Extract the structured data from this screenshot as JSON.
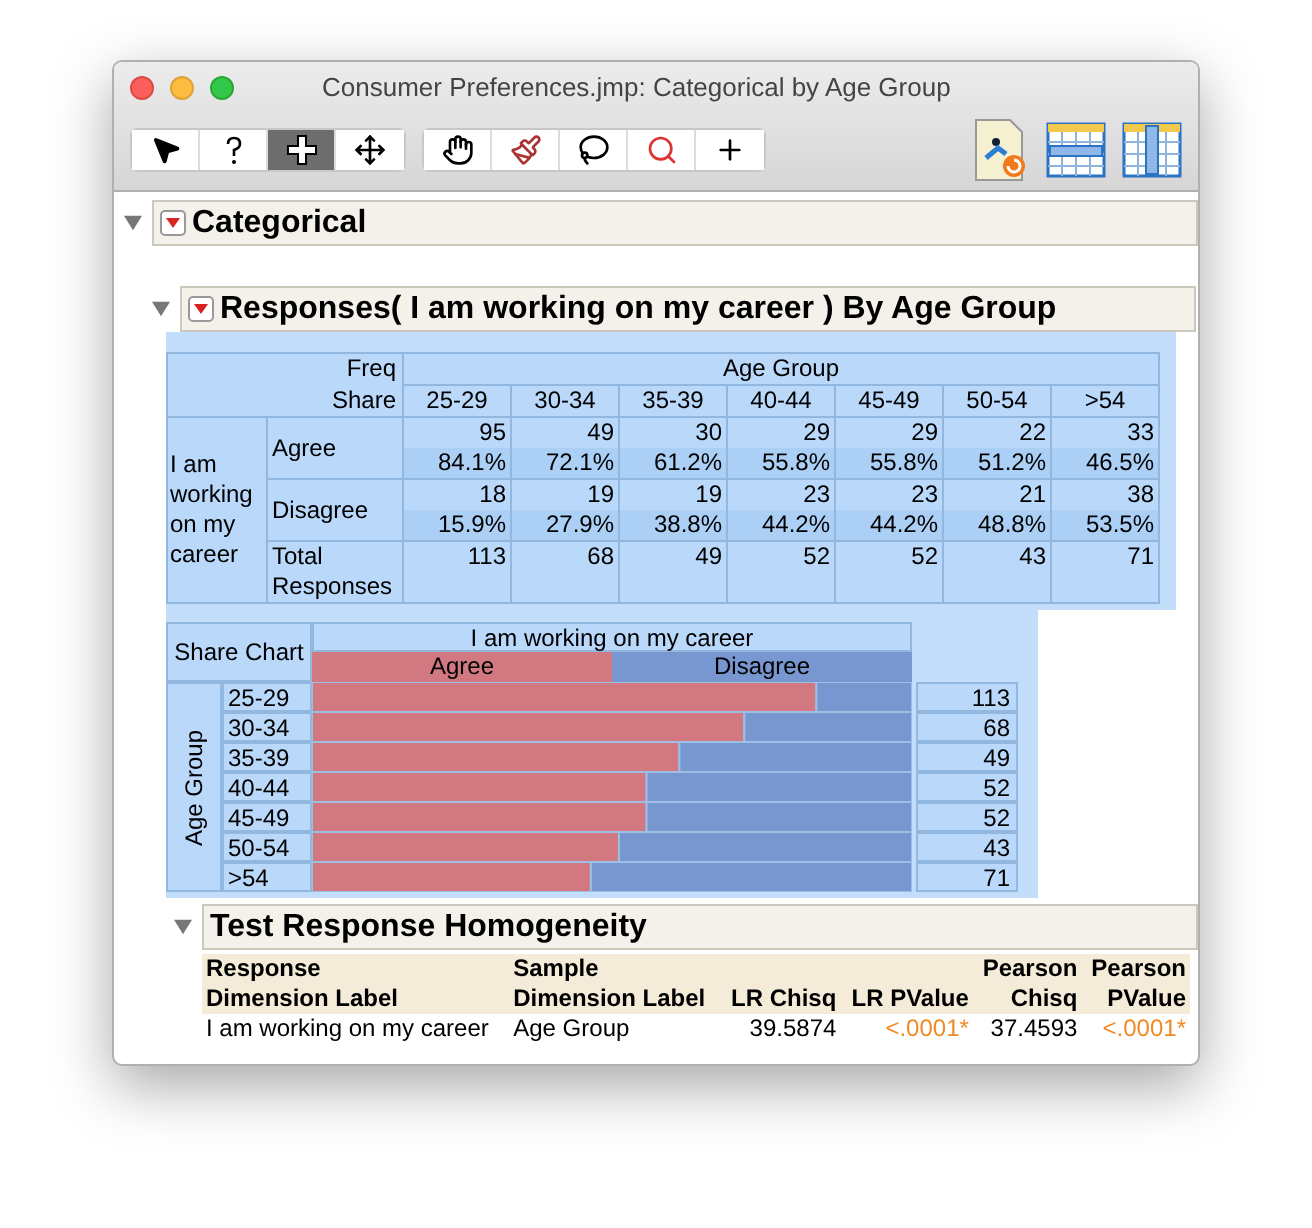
{
  "window": {
    "title": "Consumer Preferences.jmp: Categorical by Age Group"
  },
  "toolbar": {
    "tools": [
      {
        "kind": "arrow",
        "selected": false
      },
      {
        "kind": "help",
        "selected": false
      },
      {
        "kind": "crosshair",
        "selected": true
      },
      {
        "kind": "move",
        "selected": false
      },
      {
        "kind": "hand",
        "selected": false
      },
      {
        "kind": "brush",
        "selected": false
      },
      {
        "kind": "lasso",
        "selected": false
      },
      {
        "kind": "magnifier",
        "selected": false
      },
      {
        "kind": "crosshair_xy",
        "selected": false
      }
    ]
  },
  "report": {
    "title": "Categorical",
    "expanded": true,
    "responses": {
      "title": "Responses( I am working on my career ) By Age Group",
      "expanded": true,
      "contingency": {
        "freq_label": "Freq",
        "share_label": "Share",
        "group_header": "Age Group",
        "columns": [
          "25-29",
          "30-34",
          "35-39",
          "40-44",
          "45-49",
          "50-54",
          ">54"
        ],
        "row_variable": "I am working on my career",
        "rows": [
          {
            "label": "Agree",
            "counts": [
              "95",
              "49",
              "30",
              "29",
              "29",
              "22",
              "33"
            ],
            "shares": [
              "84.1%",
              "72.1%",
              "61.2%",
              "55.8%",
              "55.8%",
              "51.2%",
              "46.5%"
            ]
          },
          {
            "label": "Disagree",
            "counts": [
              "18",
              "19",
              "19",
              "23",
              "23",
              "21",
              "38"
            ],
            "shares": [
              "15.9%",
              "27.9%",
              "38.8%",
              "44.2%",
              "44.2%",
              "48.8%",
              "53.5%"
            ]
          }
        ],
        "total_label": "Total Responses",
        "totals": [
          "113",
          "68",
          "49",
          "52",
          "52",
          "43",
          "71"
        ]
      },
      "share_chart": {
        "title": "Share Chart",
        "header": "I am working on my career",
        "group_label": "Age Group",
        "totals": [
          "113",
          "68",
          "49",
          "52",
          "52",
          "43",
          "71"
        ],
        "categories": [
          "25-29",
          "30-34",
          "35-39",
          "40-44",
          "45-49",
          "50-54",
          ">54"
        ],
        "legend": [
          {
            "name": "Agree",
            "color": "#d27880"
          },
          {
            "name": "Disagree",
            "color": "#7897d1"
          }
        ]
      }
    },
    "homogeneity": {
      "title": "Test Response Homogeneity",
      "expanded": true,
      "columns": [
        {
          "lines": [
            "Response",
            "Dimension Label"
          ]
        },
        {
          "lines": [
            "Sample",
            "Dimension Label"
          ]
        },
        {
          "lines": [
            "LR Chisq"
          ]
        },
        {
          "lines": [
            "LR PValue"
          ]
        },
        {
          "lines": [
            "Pearson",
            "Chisq"
          ]
        },
        {
          "lines": [
            "Pearson",
            "PValue"
          ]
        }
      ],
      "rows": [
        [
          {
            "text": "I am working on my career",
            "kind": "text"
          },
          {
            "text": "Age Group",
            "kind": "text"
          },
          {
            "text": "39.5874",
            "kind": "number"
          },
          {
            "text": "<.0001*",
            "kind": "pvalue"
          },
          {
            "text": "37.4593",
            "kind": "number"
          },
          {
            "text": "<.0001*",
            "kind": "pvalue"
          }
        ]
      ]
    }
  }
}
